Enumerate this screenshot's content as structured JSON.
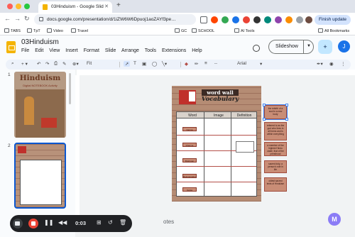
{
  "browser": {
    "tab_title": "03Hinduism - Google Slid",
    "url": "docs.google.com/presentation/d/1iZW6W6Dpuoj1aoZAYf3pe…",
    "finish_update": "Finish update",
    "bookmarks": [
      "TABS",
      "TpT",
      "Video",
      "Travel",
      "GC",
      "SCHOOL",
      "AI Tools"
    ],
    "all_bookmarks": "All Bookmarks"
  },
  "doc": {
    "title": "03Hinduism",
    "menu": [
      "File",
      "Edit",
      "View",
      "Insert",
      "Format",
      "Slide",
      "Arrange",
      "Tools",
      "Extensions",
      "Help"
    ],
    "slideshow": "Slideshow",
    "avatar_letter": "J"
  },
  "toolbar": {
    "zoom": "Fit",
    "font": "Arial"
  },
  "slides": [
    {
      "number": "1",
      "title": "Hinduism",
      "subtitle": "Digital NOTEBOOK Activity"
    },
    {
      "number": "2"
    }
  ],
  "slide": {
    "banner": "word wall",
    "title": "Vocabulary",
    "headers": [
      "Word",
      "Image",
      "Definition"
    ],
    "words": [
      "Karma",
      "Dharma",
      "Brahman",
      "Reincarnation",
      "Vedas"
    ],
    "cards": [
      "the rebirth of a soul in a new body",
      "referred to as the god who lives in all forms and is within everything",
      "a member of the highest Hindu caste, that of the priesthood",
      "sacred duty, a person's role in life",
      "oldest sacred texts of Hinduism"
    ]
  },
  "notes": "otes",
  "recorder": {
    "time": "0:03"
  }
}
